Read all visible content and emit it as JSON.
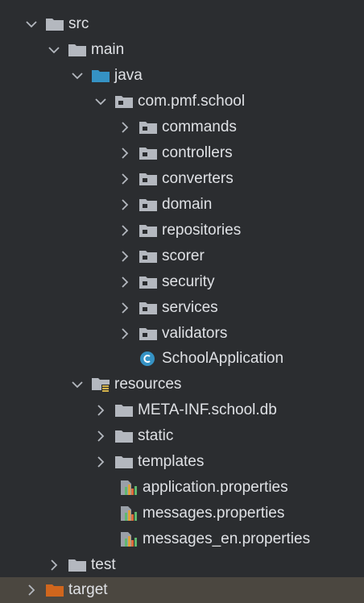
{
  "tree": {
    "rows": [
      {
        "label": "src",
        "icon": "folder-gray-icon",
        "expanded": true
      },
      {
        "label": "main",
        "icon": "folder-gray-icon",
        "expanded": true
      },
      {
        "label": "java",
        "icon": "folder-blue-source-icon",
        "expanded": true
      },
      {
        "label": "com.pmf.school",
        "icon": "package-icon",
        "expanded": true
      },
      {
        "label": "commands",
        "icon": "package-icon",
        "expanded": false
      },
      {
        "label": "controllers",
        "icon": "package-icon",
        "expanded": false
      },
      {
        "label": "converters",
        "icon": "package-icon",
        "expanded": false
      },
      {
        "label": "domain",
        "icon": "package-icon",
        "expanded": false
      },
      {
        "label": "repositories",
        "icon": "package-icon",
        "expanded": false
      },
      {
        "label": "scorer",
        "icon": "package-icon",
        "expanded": false
      },
      {
        "label": "security",
        "icon": "package-icon",
        "expanded": false
      },
      {
        "label": "services",
        "icon": "package-icon",
        "expanded": false
      },
      {
        "label": "validators",
        "icon": "package-icon",
        "expanded": false
      },
      {
        "label": "SchoolApplication",
        "icon": "java-class-icon",
        "expanded": null
      },
      {
        "label": "resources",
        "icon": "resources-folder-icon",
        "expanded": true
      },
      {
        "label": "META-INF.school.db",
        "icon": "folder-gray-icon",
        "expanded": false
      },
      {
        "label": "static",
        "icon": "folder-gray-icon",
        "expanded": false
      },
      {
        "label": "templates",
        "icon": "folder-gray-icon",
        "expanded": false
      },
      {
        "label": "application.properties",
        "icon": "properties-file-icon",
        "expanded": null
      },
      {
        "label": "messages.properties",
        "icon": "properties-file-icon",
        "expanded": null
      },
      {
        "label": "messages_en.properties",
        "icon": "properties-file-icon",
        "expanded": null
      },
      {
        "label": "test",
        "icon": "folder-gray-icon",
        "expanded": false
      },
      {
        "label": "target",
        "icon": "folder-orange-excluded-icon",
        "expanded": false,
        "selected": true
      }
    ]
  },
  "colors": {
    "background": "#2b2d30",
    "text": "#dfe1e5",
    "folder": "#b4b8bf",
    "source_folder": "#3592c4",
    "excluded_folder": "#d0661d",
    "selected_row": "#4b4740",
    "class_icon": "#3592c4"
  }
}
